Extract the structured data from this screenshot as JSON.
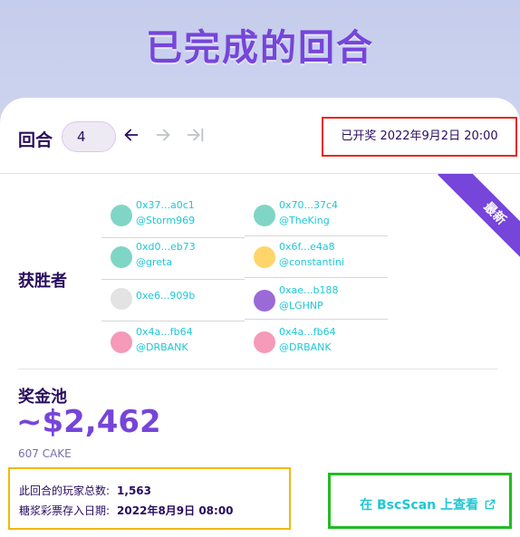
{
  "page": {
    "title": "已完成的回合"
  },
  "header": {
    "round_label": "回合",
    "round_value": "4",
    "draw_date": "已开奖 2022年9月2日 20:00"
  },
  "ribbon": {
    "label": "最新"
  },
  "winners": {
    "label": "获胜者",
    "left": [
      {
        "address": "0x37...a0c1",
        "handle": "@Storm969",
        "avatar_color": "#7fd6c6"
      },
      {
        "address": "0xd0...eb73",
        "handle": "@greta",
        "avatar_color": "#7fd6c6"
      },
      {
        "address": "0xe6...909b",
        "handle": "",
        "avatar_color": "#e3e3e3"
      },
      {
        "address": "0x4a...fb64",
        "handle": "@DRBANK",
        "avatar_color": "#f59ab8"
      }
    ],
    "right": [
      {
        "address": "0x70...37c4",
        "handle": "@TheKing",
        "avatar_color": "#7fd6c6"
      },
      {
        "address": "0x6f...e4a8",
        "handle": "@constantini",
        "avatar_color": "#ffd56b"
      },
      {
        "address": "0xae...b188",
        "handle": "@LGHNP",
        "avatar_color": "#9a6ad6"
      },
      {
        "address": "0x4a...fb64",
        "handle": "@DRBANK",
        "avatar_color": "#f59ab8"
      }
    ]
  },
  "prize": {
    "label": "奖金池",
    "value": "~$2,462",
    "cake": "607 CAKE"
  },
  "stats": {
    "players_label": "此回合的玩家总数:",
    "players_value": "1,563",
    "deposit_label": "糖浆彩票存入日期:",
    "deposit_value": "2022年8月9日 08:00"
  },
  "bscscan": {
    "label": "在 BscScan 上查看"
  },
  "colors": {
    "accent": "#7645d9",
    "link": "#1fc7d4",
    "text": "#280d5f",
    "highlight_red": "#e8271f",
    "highlight_yellow": "#f0b90b",
    "highlight_green": "#22bb22"
  }
}
